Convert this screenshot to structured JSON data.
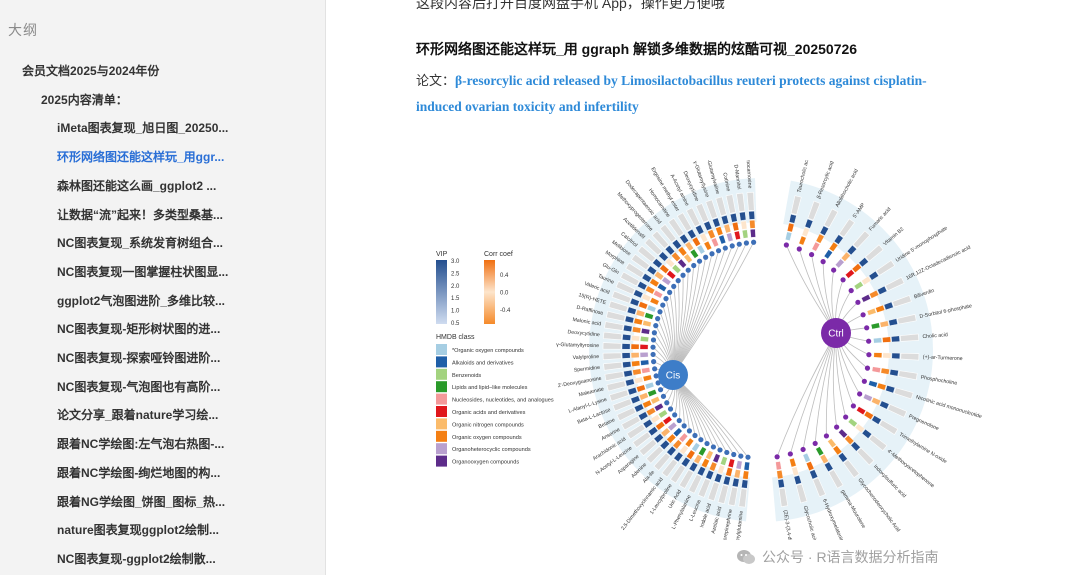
{
  "sidebar": {
    "title": "大纲",
    "items": [
      {
        "label": "会员文档2025与2024年份",
        "level": 1
      },
      {
        "label": "2025内容清单：",
        "level": 2
      },
      {
        "label": "iMeta图表复现_旭日图_20250...",
        "level": 3
      },
      {
        "label": "环形网络图还能这样玩_用ggr...",
        "level": 3,
        "active": true
      },
      {
        "label": "森林图还能这么画_ggplot2 ...",
        "level": 3
      },
      {
        "label": "让数据“流”起来！多类型桑基...",
        "level": 3
      },
      {
        "label": "NC图表复现_系统发育树组合...",
        "level": 3
      },
      {
        "label": "NC图表复现一图掌握柱状图显...",
        "level": 3
      },
      {
        "label": "ggplot2气泡图进阶_多维比较...",
        "level": 3
      },
      {
        "label": "NC图表复现-矩形树状图的进...",
        "level": 3
      },
      {
        "label": "NC图表复现-探索哑铃图进阶...",
        "level": 3
      },
      {
        "label": "NC图表复现-气泡图也有高阶...",
        "level": 3
      },
      {
        "label": "论文分享_跟着nature学习绘...",
        "level": 3
      },
      {
        "label": "跟着NC学绘图:左气泡右热图-...",
        "level": 3
      },
      {
        "label": "跟着NC学绘图-绚烂地图的构...",
        "level": 3
      },
      {
        "label": "跟着NG学绘图_饼图_图标_热...",
        "level": 3
      },
      {
        "label": "nature图表复现ggplot2绘制...",
        "level": 3
      },
      {
        "label": "NC图表复现-ggplot2绘制散...",
        "level": 3
      }
    ]
  },
  "main": {
    "top_cut_text": "这段内容后打开百度网盘手机 App，操作更方便哦",
    "article_title": "环形网络图还能这样玩_用 ggraph 解锁多维数据的炫酷可视_20250726",
    "paper_label": "论文：",
    "paper_title": "β-resorcylic acid released by Limosilactobacillus reuteri protects against cisplatin-induced ovarian toxicity and infertility",
    "watermark": "公众号 · R语言数据分析指南"
  },
  "figure": {
    "hub_cis": "Cis",
    "hub_ctrl": "Ctrl",
    "colors": {
      "cis_hub": "#3d7dc8",
      "ctrl_hub": "#7b2aa8",
      "cis_dot": "#3d6fb7",
      "ctrl_dot": "#7b2aa8",
      "edge": "#bdbdbd",
      "link": "#2e8ad8"
    },
    "legend": {
      "vip_title": "VIP",
      "vip_ticks": [
        "3.0",
        "2.5",
        "2.0",
        "1.5",
        "1.0",
        "0.5"
      ],
      "corr_title": "Corr coef",
      "corr_ticks": [
        "0.4",
        "0.0",
        "-0.4"
      ],
      "hmdb_title": "HMDB class",
      "hmdb": [
        {
          "label": "*Organic oxygen compounds",
          "color": "#a6cee3"
        },
        {
          "label": "Alkaloids and derivatives",
          "color": "#1f5fa8"
        },
        {
          "label": "Benzenoids",
          "color": "#a3d37f"
        },
        {
          "label": "Lipids and lipid−like molecules",
          "color": "#2a9a2a"
        },
        {
          "label": "Nucleosides, nucleotides, and analogues",
          "color": "#f4999a"
        },
        {
          "label": "Organic acids and derivatives",
          "color": "#e0171c"
        },
        {
          "label": "Organic nitrogen compounds",
          "color": "#fbbb6a"
        },
        {
          "label": "Organic oxygen compounds",
          "color": "#f47f13"
        },
        {
          "label": "Organoheterocyclic compounds",
          "color": "#b9a0cf"
        },
        {
          "label": "Organooxygen compounds",
          "color": "#5d2c8a"
        }
      ]
    },
    "metabolites": [
      "Taurocholic acid",
      "β-Resorcylic acid",
      "Allolithocholic acid",
      "5'-AMP",
      "Fumaric acid",
      "Vitamin B2",
      "Uridine 5'-monophosphate",
      "16R,12Z-Octadecadienoic acid",
      "Biliverdin",
      "D-Sorbitol 6-phosphate",
      "Cholic acid",
      "(+)-ar-Turmerone",
      "Phosphocholine",
      "Nicotinic acid mononucleotide",
      "Pregnenolone",
      "Trimethylamine N-oxide",
      "4'-Methoxyacetophenone",
      "Indoxylsulfuric acid",
      "Glycochenodeoxycholic Acid",
      "gamma-Muurolene",
      "6-Hydroxymelatonin",
      "Glycocholic acid",
      "(2E)-3-(3,4-dimethoxyphenyl)acrylic acid",
      "γ-Glutamylglutamine",
      "Norepinephrine",
      "Azelaic acid",
      "Indole acid",
      "L-Leucine",
      "L-Phenylalanine",
      "Uric Acid",
      "1-Leucylproline",
      "2,5-Dimethoxycinnamic acid",
      "Ala-Ile",
      "Adenine",
      "Asparagine",
      "N-Acetyl-L-Leucine",
      "Arachidonic acid",
      "Anserine",
      "Betaine",
      "Beta-L-Lactose",
      "L-Alanyl-L-Lysine",
      "Maleamate",
      "2'-Deoxyguanosine",
      "Spermidine",
      "Valylproline",
      "γ-Glutamyltyrosine",
      "Deoxycytidine",
      "Malonic acid",
      "D-Raffinose",
      "15(R)-HETE",
      "Valeric acid",
      "Taurine",
      "Glu-Gln",
      "Morphine",
      "Melibiose",
      "Calcitriol",
      "Acetildenafil",
      "Methoxyprogesterone",
      "Dodecapentaenoic acid",
      "Homocarnitine",
      "Ergosine methyl ester",
      "A-Acetyl amine",
      "Deoxycytidine",
      "γ-Glutamyllysine",
      "γ-Glutamylvaline",
      "Cotinine",
      "D-Mannitol",
      "Homocarnosine"
    ],
    "split_index": 23
  }
}
